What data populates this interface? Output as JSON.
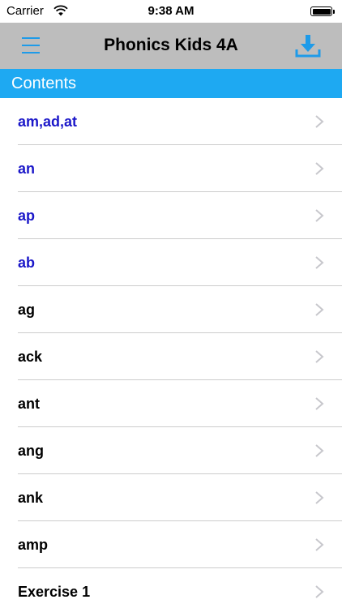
{
  "status_bar": {
    "carrier": "Carrier",
    "time": "9:38 AM",
    "wifi_icon": "wifi-icon",
    "battery_icon": "battery-icon"
  },
  "nav_bar": {
    "title": "Phonics Kids 4A",
    "menu_icon": "hamburger-menu-icon",
    "download_icon": "download-icon",
    "accent_color": "#1e9be9",
    "background_color": "#bdbdbd"
  },
  "section": {
    "title": "Contents",
    "background_color": "#1ea9f2"
  },
  "list": {
    "chevron_icon": "chevron-right-icon",
    "highlight_color": "#1b17c9",
    "items": [
      {
        "label": "am,ad,at",
        "highlighted": true
      },
      {
        "label": "an",
        "highlighted": true
      },
      {
        "label": "ap",
        "highlighted": true
      },
      {
        "label": "ab",
        "highlighted": true
      },
      {
        "label": "ag",
        "highlighted": false
      },
      {
        "label": "ack",
        "highlighted": false
      },
      {
        "label": "ant",
        "highlighted": false
      },
      {
        "label": "ang",
        "highlighted": false
      },
      {
        "label": "ank",
        "highlighted": false
      },
      {
        "label": "amp",
        "highlighted": false
      },
      {
        "label": "Exercise 1",
        "highlighted": false
      }
    ]
  }
}
